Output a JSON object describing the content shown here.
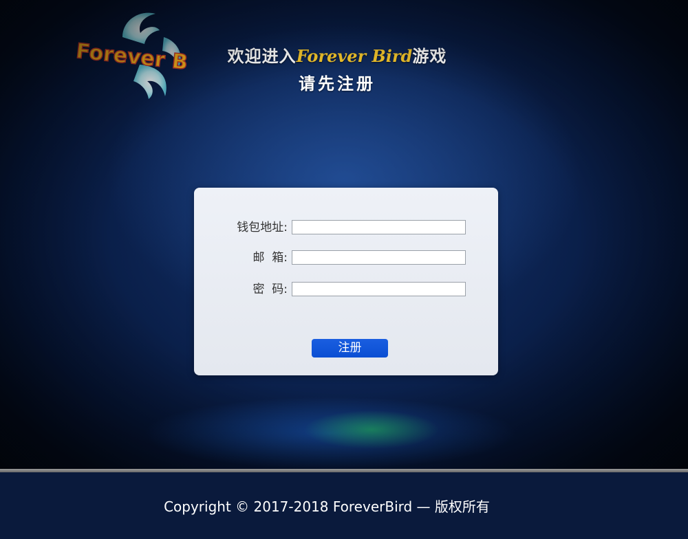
{
  "logo": {
    "text": "Forever Bird"
  },
  "header": {
    "welcome_prefix": "欢迎进入",
    "welcome_brand": "Forever Bird",
    "welcome_suffix": "游戏",
    "subtitle": "请先注册"
  },
  "form": {
    "wallet_label": "钱包地址:",
    "wallet_value": "",
    "email_label": "邮  箱:",
    "email_value": "",
    "password_label": "密  码:",
    "password_value": "",
    "submit_label": "注册"
  },
  "footer": {
    "copyright": "Copyright © 2017-2018 ForeverBird — 版权所有"
  },
  "colors": {
    "brand_gold": "#f3c52c",
    "button_blue": "#0b4fd3",
    "footer_bg": "#0a1a3c"
  }
}
